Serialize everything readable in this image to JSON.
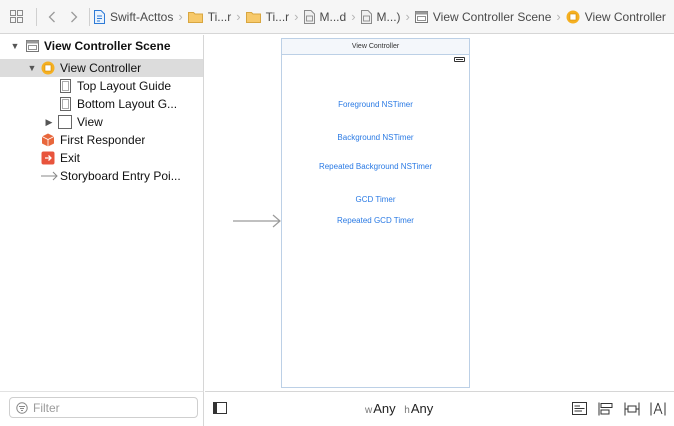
{
  "jumpbar": {
    "crumbs": [
      {
        "label": "Swift-Acttos",
        "icon": "project-file-icon"
      },
      {
        "label": "Ti...r",
        "icon": "folder-icon"
      },
      {
        "label": "Ti...r",
        "icon": "folder-icon"
      },
      {
        "label": "M...d",
        "icon": "storyboard-file-icon"
      },
      {
        "label": "M...)",
        "icon": "storyboard-file-icon"
      },
      {
        "label": "View Controller Scene",
        "icon": "scene-icon"
      },
      {
        "label": "View Controller",
        "icon": "view-controller-icon"
      }
    ]
  },
  "outline": {
    "scene": "View Controller Scene",
    "view_controller": "View Controller",
    "top_layout_guide": "Top Layout Guide",
    "bottom_layout_guide": "Bottom Layout G...",
    "view": "View",
    "first_responder": "First Responder",
    "exit": "Exit",
    "entry_point": "Storyboard Entry Poi..."
  },
  "filter": {
    "placeholder": "Filter"
  },
  "canvas": {
    "scene_title": "View Controller",
    "buttons": [
      "Foreground NSTimer",
      "Background NSTimer",
      "Repeated Background NSTimer",
      "GCD Timer",
      "Repeated GCD Timer"
    ]
  },
  "bottombar": {
    "width_key": "w",
    "width_value": "Any",
    "height_key": "h",
    "height_value": "Any"
  },
  "colors": {
    "accent_blue": "#2a7ae4",
    "selection": "#dcdcdc",
    "vc_icon": "#f5b021",
    "first_responder_icon": "#e8673c",
    "exit_icon": "#e8543c"
  }
}
